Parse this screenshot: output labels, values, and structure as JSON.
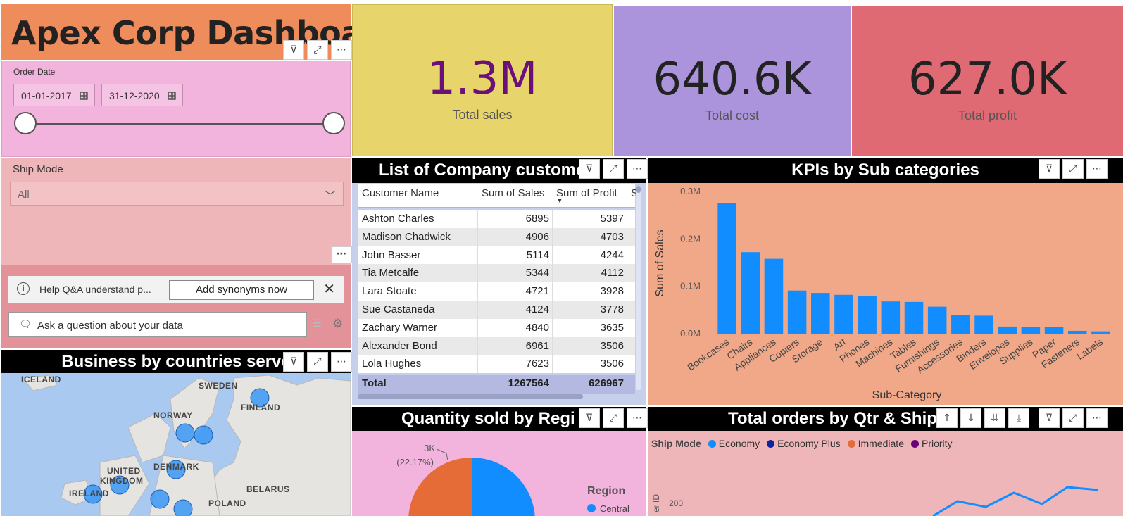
{
  "title": "Apex Corp Dashboard",
  "order_date": {
    "label": "Order Date",
    "start": "01-01-2017",
    "end": "31-12-2020"
  },
  "ship_mode": {
    "label": "Ship Mode",
    "selected": "All"
  },
  "qna": {
    "help_text": "Help Q&A understand p...",
    "add_synonyms": "Add synonyms now",
    "ask_placeholder": "Ask a question about your data"
  },
  "kpis": {
    "sales": {
      "value": "1.3M",
      "caption": "Total sales",
      "color": "#6b0f7a"
    },
    "cost": {
      "value": "640.6K",
      "caption": "Total cost",
      "color": "#222222"
    },
    "profit": {
      "value": "627.0K",
      "caption": "Total profit",
      "color": "#222222"
    }
  },
  "customers": {
    "title": "List of Company custome",
    "columns": [
      "Customer Name",
      "Sum of Sales",
      "Sum of Profit",
      "S"
    ],
    "rows": [
      [
        "Ashton Charles",
        "6895",
        "5397"
      ],
      [
        "Madison Chadwick",
        "4906",
        "4703"
      ],
      [
        "John Basser",
        "5114",
        "4244"
      ],
      [
        "Tia Metcalfe",
        "5344",
        "4112"
      ],
      [
        "Lara Stoate",
        "4721",
        "3928"
      ],
      [
        "Sue Castaneda",
        "4124",
        "3778"
      ],
      [
        "Zachary Warner",
        "4840",
        "3635"
      ],
      [
        "Alexander Bond",
        "6961",
        "3506"
      ],
      [
        "Lola Hughes",
        "7623",
        "3506"
      ]
    ],
    "total": [
      "Total",
      "1267564",
      "626967"
    ]
  },
  "map": {
    "title": "Business by countries serve",
    "labels": [
      "ICELAND",
      "SWEDEN",
      "FINLAND",
      "NORWAY",
      "UNITED",
      "KINGDOM",
      "DENMARK",
      "IRELAND",
      "BELARUS",
      "POLAND"
    ]
  },
  "pie": {
    "title": "Quantity sold by Regi",
    "label_value": "3K",
    "label_pct": "(22.17%)",
    "legend_title": "Region",
    "legend_first": "Central"
  },
  "line": {
    "title": "Total orders by Qtr & Ship",
    "legend_title": "Ship Mode",
    "series": [
      {
        "name": "Economy",
        "color": "#118dff"
      },
      {
        "name": "Economy Plus",
        "color": "#12239e"
      },
      {
        "name": "Immediate",
        "color": "#e66c37"
      },
      {
        "name": "Priority",
        "color": "#6b007b"
      }
    ],
    "ylabel": "er ID",
    "ytick": "200"
  },
  "chart_data": {
    "type": "bar",
    "title": "KPIs by Sub categories",
    "xlabel": "Sub-Category",
    "ylabel": "Sum of Sales",
    "ylim": [
      0,
      0.3
    ],
    "yticks": [
      "0.0M",
      "0.1M",
      "0.2M",
      "0.3M"
    ],
    "categories": [
      "Bookcases",
      "Chairs",
      "Appliances",
      "Copiers",
      "Storage",
      "Art",
      "Phones",
      "Machines",
      "Tables",
      "Furnishings",
      "Accessories",
      "Binders",
      "Envelopes",
      "Supplies",
      "Paper",
      "Fasteners",
      "Labels"
    ],
    "values": [
      0.276,
      0.172,
      0.158,
      0.091,
      0.086,
      0.082,
      0.079,
      0.068,
      0.067,
      0.057,
      0.039,
      0.038,
      0.015,
      0.014,
      0.014,
      0.006,
      0.005
    ],
    "bar_color": "#118dff",
    "grid": false
  }
}
